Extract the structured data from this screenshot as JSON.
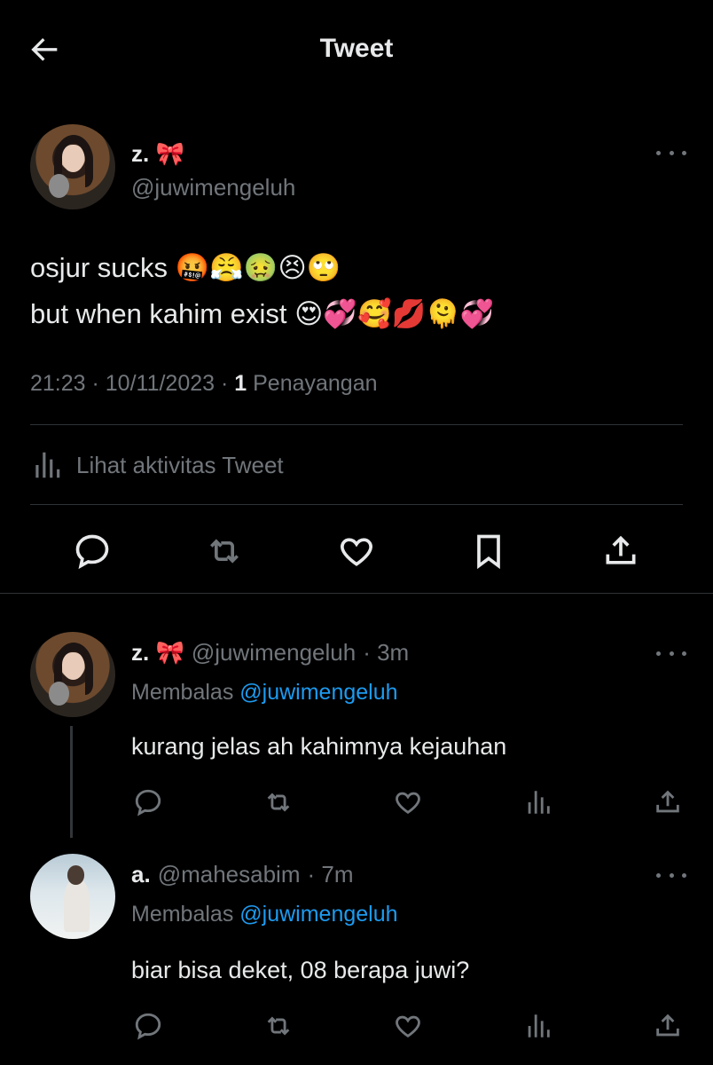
{
  "header": {
    "title": "Tweet"
  },
  "main_tweet": {
    "display_name": "z. 🎀",
    "handle": "@juwimengeluh",
    "line1": "osjur sucks 🤬😤🤢😣🙄",
    "line2": "but when kahim exist 😍💞🥰💋🫠💞",
    "time": "21:23 · 10/11/2023 · ",
    "views_count": "1",
    "views_label": " Penayangan",
    "activity_label": "Lihat aktivitas Tweet"
  },
  "replies": [
    {
      "display_name": "z. 🎀",
      "handle": "@juwimengeluh",
      "time": "· 3m",
      "replying_prefix": "Membalas ",
      "replying_to": "@juwimengeluh",
      "text": "kurang jelas ah kahimnya kejauhan"
    },
    {
      "display_name": "a.",
      "handle": "@mahesabim",
      "time": "· 7m",
      "replying_prefix": "Membalas ",
      "replying_to": "@juwimengeluh",
      "text": "biar bisa deket, 08 berapa juwi?"
    }
  ],
  "colors": {
    "background": "#000000",
    "text": "#e7e9ea",
    "muted": "#71767b",
    "accent": "#1d9bf0",
    "divider": "#2f3336"
  },
  "icons": [
    "back-arrow-icon",
    "more-icon",
    "reply-icon",
    "retweet-icon",
    "like-icon",
    "bookmark-icon",
    "share-icon",
    "analytics-icon"
  ]
}
